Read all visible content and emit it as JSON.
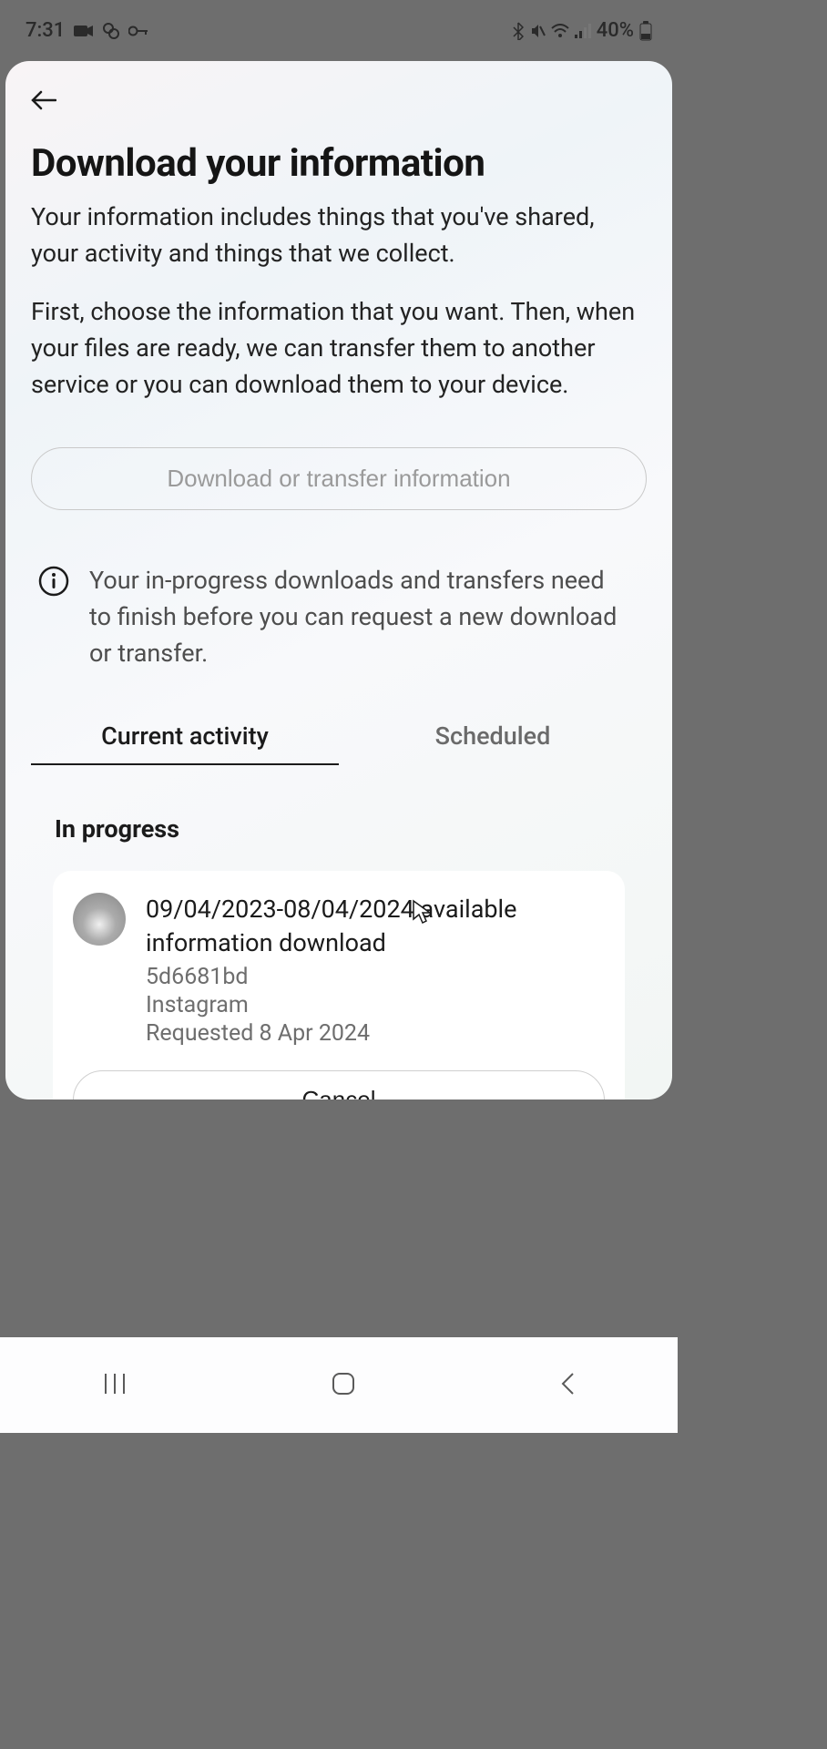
{
  "status": {
    "time": "7:31",
    "battery_label": "40%"
  },
  "page": {
    "title": "Download your information",
    "desc1": "Your information includes things that you've shared, your activity and things that we collect.",
    "desc2": "First, choose the information that you want. Then, when your files are ready, we can transfer them to another service or you can download them to your device."
  },
  "primary_button": {
    "label": "Download or transfer information"
  },
  "notice": {
    "text": "Your in-progress downloads and transfers need to finish before you can request a new download or transfer."
  },
  "tabs": {
    "current": "Current activity",
    "scheduled": "Scheduled"
  },
  "section": {
    "heading": "In progress"
  },
  "activity": {
    "title": "09/04/2023-08/04/2024 available information download",
    "id": "5d6681bd",
    "platform": "Instagram",
    "requested": "Requested 8 Apr 2024",
    "cancel_label": "Cancel"
  }
}
